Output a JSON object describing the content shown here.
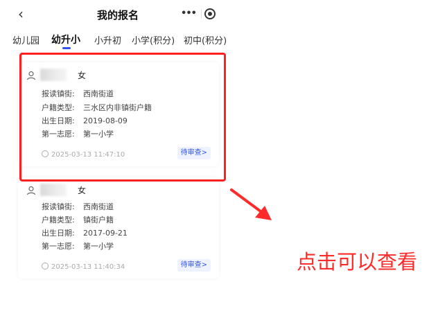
{
  "header": {
    "back_icon": "chevron-left-icon",
    "title": "我的报名",
    "more_icon": "more-dots-icon",
    "close_icon": "target-close-icon"
  },
  "tabs": [
    {
      "label": "幼儿园",
      "active": false
    },
    {
      "label": "幼升小",
      "active": true
    },
    {
      "label": "小升初",
      "active": false
    },
    {
      "label": "小学(积分)",
      "active": false
    },
    {
      "label": "初中(积分)",
      "active": false
    }
  ],
  "records": [
    {
      "gender": "女",
      "fields": [
        {
          "label": "报读镇街:",
          "value": "西南街道"
        },
        {
          "label": "户籍类型:",
          "value": "三水区内非镇街户籍"
        },
        {
          "label": "出生日期:",
          "value": "2019-08-09"
        },
        {
          "label": "第一志愿:",
          "value": "第一小学"
        }
      ],
      "time": "2025-03-13 11:47:10",
      "status": "待审查>"
    },
    {
      "gender": "女",
      "fields": [
        {
          "label": "报读镇街:",
          "value": "西南街道"
        },
        {
          "label": "户籍类型:",
          "value": "镇街户籍"
        },
        {
          "label": "出生日期:",
          "value": "2017-09-21"
        },
        {
          "label": "第一志愿:",
          "value": "第一小学"
        }
      ],
      "time": "2025-03-13 11:40:34",
      "status": "待审查>"
    }
  ],
  "annotation": {
    "text": "点击可以查看",
    "color": "#ff2a2a"
  },
  "colors": {
    "accent": "#2f54eb",
    "highlight": "#ff1f1f"
  }
}
